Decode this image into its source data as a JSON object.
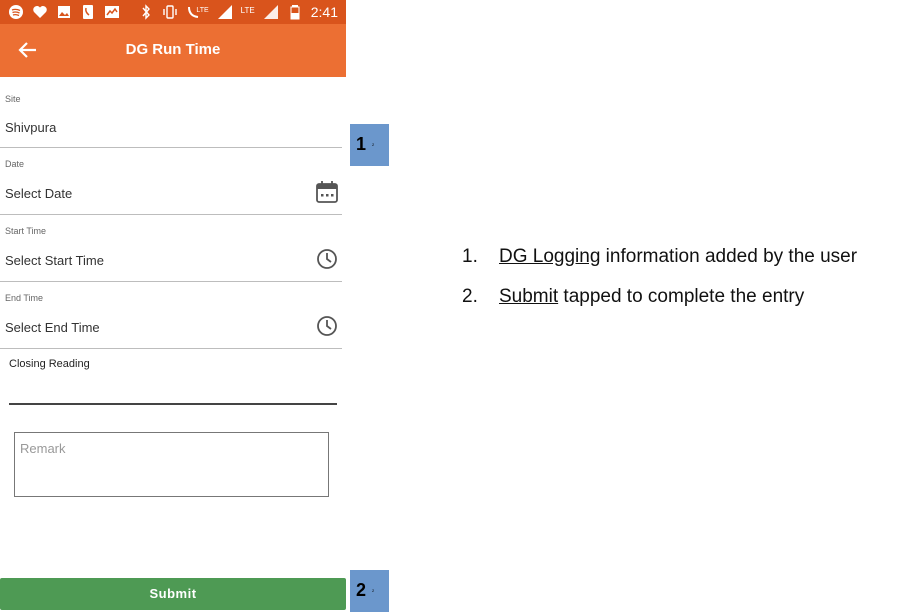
{
  "status_bar": {
    "time": "2:41",
    "left_icons": [
      "spotify-icon",
      "heart-icon",
      "image-icon",
      "phone-icon",
      "chart-icon"
    ],
    "right_icons": [
      "bluetooth-icon",
      "vibrate-icon",
      "lte-call-icon",
      "signal-icon",
      "lte-signal-icon",
      "battery-icon"
    ],
    "lte_label_1": "LTE",
    "lte_label_2": "LTE"
  },
  "app_bar": {
    "title": "DG Run Time",
    "back_icon": "arrow-left-icon"
  },
  "form": {
    "site": {
      "label": "Site",
      "value": "Shivpura"
    },
    "date": {
      "label": "Date",
      "value": "Select Date",
      "icon": "calendar-icon"
    },
    "start_time": {
      "label": "Start Time",
      "value": "Select Start Time",
      "icon": "clock-icon"
    },
    "end_time": {
      "label": "End Time",
      "value": "Select End Time",
      "icon": "clock-icon"
    },
    "closing_reading": {
      "label": "Closing Reading",
      "value": ""
    },
    "remark": {
      "placeholder": "Remark"
    },
    "submit_label": "Submit"
  },
  "markers": [
    {
      "number": "1",
      "sub": "2"
    },
    {
      "number": "2",
      "sub": "2"
    }
  ],
  "notes": [
    {
      "index": "1.",
      "link": "DG Logging",
      "text": " information added by the user"
    },
    {
      "index": "2.",
      "link": "Submit",
      "text": " tapped to complete the entry"
    }
  ],
  "colors": {
    "status_bar": "#d9541c",
    "app_bar": "#ec6f33",
    "submit": "#4e9a54",
    "marker": "#6b97cc"
  }
}
